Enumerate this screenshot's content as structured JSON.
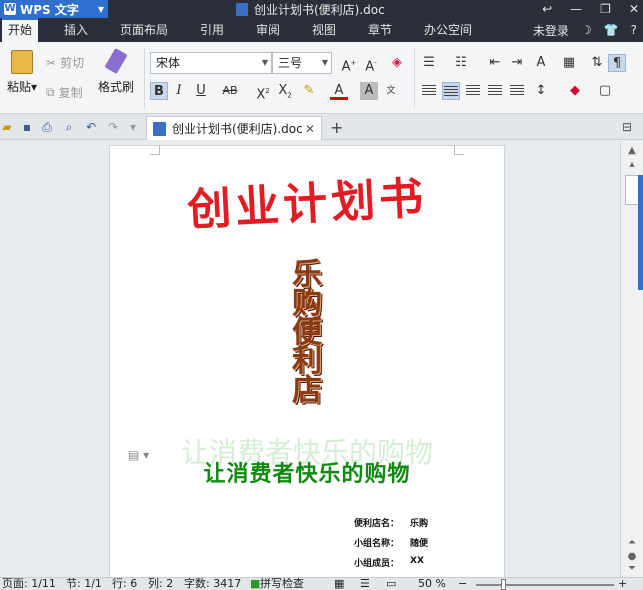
{
  "app": {
    "menu_label": "WPS 文字",
    "doc_title": "创业计划书(便利店).doc",
    "login": "未登录"
  },
  "menu_tabs": [
    "开始",
    "插入",
    "页面布局",
    "引用",
    "审阅",
    "视图",
    "章节",
    "办公空间"
  ],
  "ribbon": {
    "paste": "粘贴",
    "cut": "剪切",
    "copy": "复制",
    "format_painter": "格式刷",
    "font_name": "宋体",
    "font_size": "三号"
  },
  "tab": {
    "filename": "创业计划书(便利店).doc"
  },
  "document": {
    "title": "创业计划书",
    "vertical_chars": [
      "乐",
      "购",
      "便",
      "利",
      "店"
    ],
    "slogan_shadow": "让消费者快乐的购物",
    "slogan": "让消费者快乐的购物",
    "info": [
      {
        "key": "便利店名：",
        "value": "乐购"
      },
      {
        "key": "小组名称：",
        "value": "随便"
      },
      {
        "key": "小组成员：",
        "value": "XX"
      }
    ]
  },
  "status": {
    "page": "页面: 1/11",
    "section": "节: 1/1",
    "row": "行: 6",
    "col": "列: 2",
    "words": "字数: 3417",
    "spell": "拼写检查",
    "zoom": "50 %",
    "zoom_level": 0.2
  },
  "colors": {
    "accent": "#2f6fd0",
    "title_red": "#e31c23",
    "slogan_green": "#0f8a0f"
  }
}
